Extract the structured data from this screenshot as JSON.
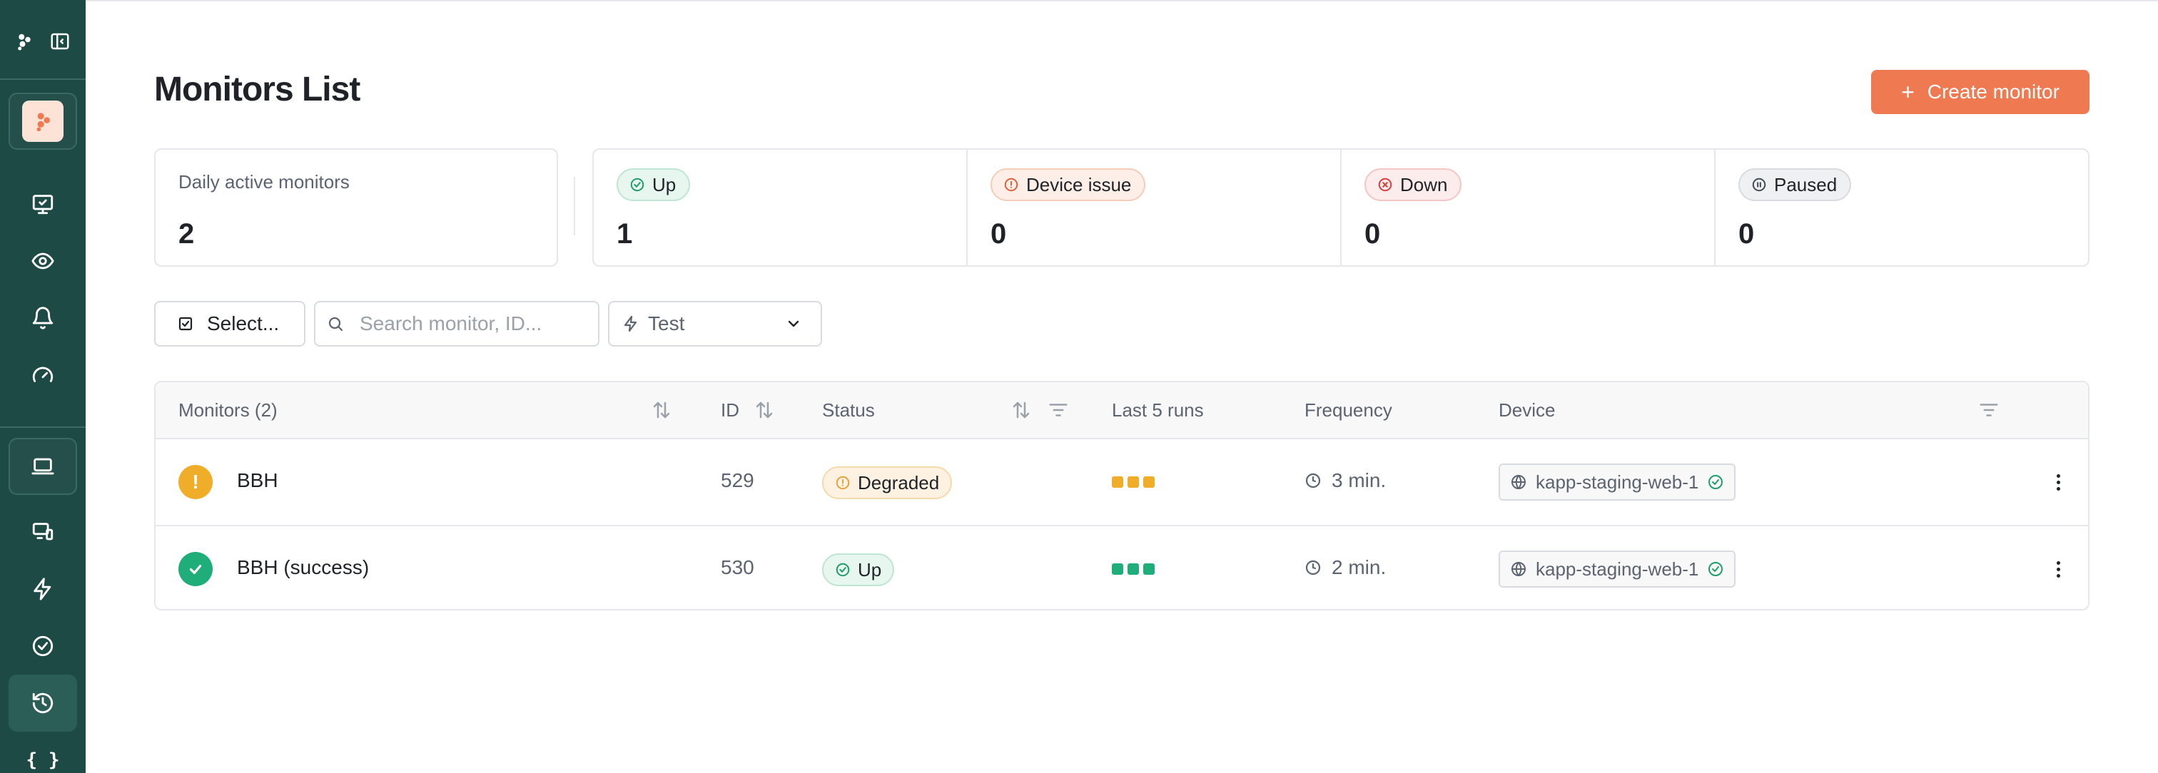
{
  "page": {
    "title": "Monitors List",
    "create_button": "Create monitor"
  },
  "sidebar": {
    "items": [
      {
        "icon": "app-logo-icon"
      },
      {
        "icon": "panel-toggle-icon"
      },
      {
        "icon": "workspace-logo-icon"
      },
      {
        "icon": "monitor-check-icon"
      },
      {
        "icon": "eye-icon"
      },
      {
        "icon": "bell-icon"
      },
      {
        "icon": "gauge-icon"
      },
      {
        "icon": "laptop-icon"
      },
      {
        "icon": "devices-icon"
      },
      {
        "icon": "bolt-icon"
      },
      {
        "icon": "check-circle-icon"
      },
      {
        "icon": "history-icon"
      },
      {
        "icon": "code-braces-icon",
        "text": "{ }"
      }
    ]
  },
  "stats": {
    "daily_label": "Daily active monitors",
    "daily_value": "2",
    "up_label": "Up",
    "up_value": "1",
    "issue_label": "Device issue",
    "issue_value": "0",
    "down_label": "Down",
    "down_value": "0",
    "paused_label": "Paused",
    "paused_value": "0"
  },
  "filters": {
    "select_label": "Select...",
    "search_placeholder": "Search monitor, ID...",
    "search_value": "",
    "environment": "Test"
  },
  "table": {
    "headers": {
      "monitors": "Monitors (2)",
      "id": "ID",
      "status": "Status",
      "last_runs": "Last 5 runs",
      "frequency": "Frequency",
      "device": "Device"
    },
    "rows": [
      {
        "name": "BBH",
        "id": "529",
        "status": "Degraded",
        "state_color": "#f0ad2a",
        "runs": [
          "#f0ad2a",
          "#f0ad2a",
          "#f0ad2a"
        ],
        "frequency": "3 min.",
        "device": "kapp-staging-web-1"
      },
      {
        "name": "BBH (success)",
        "id": "530",
        "status": "Up",
        "state_color": "#1fae7a",
        "runs": [
          "#1fae7a",
          "#1fae7a",
          "#1fae7a"
        ],
        "frequency": "2 min.",
        "device": "kapp-staging-web-1"
      }
    ]
  },
  "colors": {
    "sidebar": "#1e4a45",
    "accent": "#ef7a52",
    "success": "#1fae7a",
    "warning": "#f0ad2a"
  }
}
